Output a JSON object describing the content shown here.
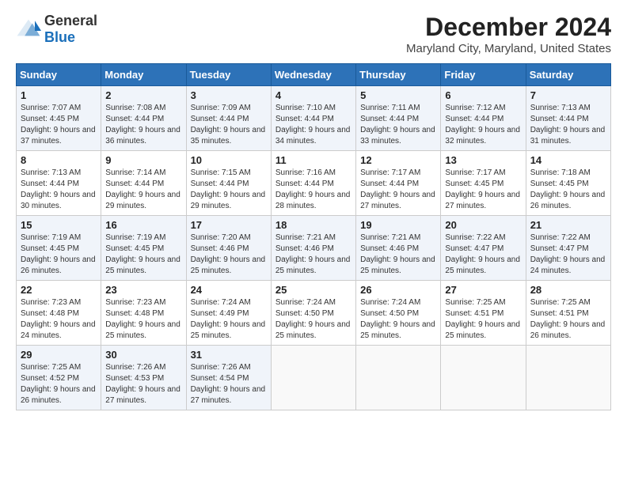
{
  "logo": {
    "general": "General",
    "blue": "Blue"
  },
  "title": {
    "month": "December 2024",
    "location": "Maryland City, Maryland, United States"
  },
  "headers": [
    "Sunday",
    "Monday",
    "Tuesday",
    "Wednesday",
    "Thursday",
    "Friday",
    "Saturday"
  ],
  "weeks": [
    [
      {
        "day": "1",
        "sunrise": "7:07 AM",
        "sunset": "4:45 PM",
        "daylight": "9 hours and 37 minutes."
      },
      {
        "day": "2",
        "sunrise": "7:08 AM",
        "sunset": "4:44 PM",
        "daylight": "9 hours and 36 minutes."
      },
      {
        "day": "3",
        "sunrise": "7:09 AM",
        "sunset": "4:44 PM",
        "daylight": "9 hours and 35 minutes."
      },
      {
        "day": "4",
        "sunrise": "7:10 AM",
        "sunset": "4:44 PM",
        "daylight": "9 hours and 34 minutes."
      },
      {
        "day": "5",
        "sunrise": "7:11 AM",
        "sunset": "4:44 PM",
        "daylight": "9 hours and 33 minutes."
      },
      {
        "day": "6",
        "sunrise": "7:12 AM",
        "sunset": "4:44 PM",
        "daylight": "9 hours and 32 minutes."
      },
      {
        "day": "7",
        "sunrise": "7:13 AM",
        "sunset": "4:44 PM",
        "daylight": "9 hours and 31 minutes."
      }
    ],
    [
      {
        "day": "8",
        "sunrise": "7:13 AM",
        "sunset": "4:44 PM",
        "daylight": "9 hours and 30 minutes."
      },
      {
        "day": "9",
        "sunrise": "7:14 AM",
        "sunset": "4:44 PM",
        "daylight": "9 hours and 29 minutes."
      },
      {
        "day": "10",
        "sunrise": "7:15 AM",
        "sunset": "4:44 PM",
        "daylight": "9 hours and 29 minutes."
      },
      {
        "day": "11",
        "sunrise": "7:16 AM",
        "sunset": "4:44 PM",
        "daylight": "9 hours and 28 minutes."
      },
      {
        "day": "12",
        "sunrise": "7:17 AM",
        "sunset": "4:44 PM",
        "daylight": "9 hours and 27 minutes."
      },
      {
        "day": "13",
        "sunrise": "7:17 AM",
        "sunset": "4:45 PM",
        "daylight": "9 hours and 27 minutes."
      },
      {
        "day": "14",
        "sunrise": "7:18 AM",
        "sunset": "4:45 PM",
        "daylight": "9 hours and 26 minutes."
      }
    ],
    [
      {
        "day": "15",
        "sunrise": "7:19 AM",
        "sunset": "4:45 PM",
        "daylight": "9 hours and 26 minutes."
      },
      {
        "day": "16",
        "sunrise": "7:19 AM",
        "sunset": "4:45 PM",
        "daylight": "9 hours and 25 minutes."
      },
      {
        "day": "17",
        "sunrise": "7:20 AM",
        "sunset": "4:46 PM",
        "daylight": "9 hours and 25 minutes."
      },
      {
        "day": "18",
        "sunrise": "7:21 AM",
        "sunset": "4:46 PM",
        "daylight": "9 hours and 25 minutes."
      },
      {
        "day": "19",
        "sunrise": "7:21 AM",
        "sunset": "4:46 PM",
        "daylight": "9 hours and 25 minutes."
      },
      {
        "day": "20",
        "sunrise": "7:22 AM",
        "sunset": "4:47 PM",
        "daylight": "9 hours and 25 minutes."
      },
      {
        "day": "21",
        "sunrise": "7:22 AM",
        "sunset": "4:47 PM",
        "daylight": "9 hours and 24 minutes."
      }
    ],
    [
      {
        "day": "22",
        "sunrise": "7:23 AM",
        "sunset": "4:48 PM",
        "daylight": "9 hours and 24 minutes."
      },
      {
        "day": "23",
        "sunrise": "7:23 AM",
        "sunset": "4:48 PM",
        "daylight": "9 hours and 25 minutes."
      },
      {
        "day": "24",
        "sunrise": "7:24 AM",
        "sunset": "4:49 PM",
        "daylight": "9 hours and 25 minutes."
      },
      {
        "day": "25",
        "sunrise": "7:24 AM",
        "sunset": "4:50 PM",
        "daylight": "9 hours and 25 minutes."
      },
      {
        "day": "26",
        "sunrise": "7:24 AM",
        "sunset": "4:50 PM",
        "daylight": "9 hours and 25 minutes."
      },
      {
        "day": "27",
        "sunrise": "7:25 AM",
        "sunset": "4:51 PM",
        "daylight": "9 hours and 25 minutes."
      },
      {
        "day": "28",
        "sunrise": "7:25 AM",
        "sunset": "4:51 PM",
        "daylight": "9 hours and 26 minutes."
      }
    ],
    [
      {
        "day": "29",
        "sunrise": "7:25 AM",
        "sunset": "4:52 PM",
        "daylight": "9 hours and 26 minutes."
      },
      {
        "day": "30",
        "sunrise": "7:26 AM",
        "sunset": "4:53 PM",
        "daylight": "9 hours and 27 minutes."
      },
      {
        "day": "31",
        "sunrise": "7:26 AM",
        "sunset": "4:54 PM",
        "daylight": "9 hours and 27 minutes."
      },
      null,
      null,
      null,
      null
    ]
  ]
}
